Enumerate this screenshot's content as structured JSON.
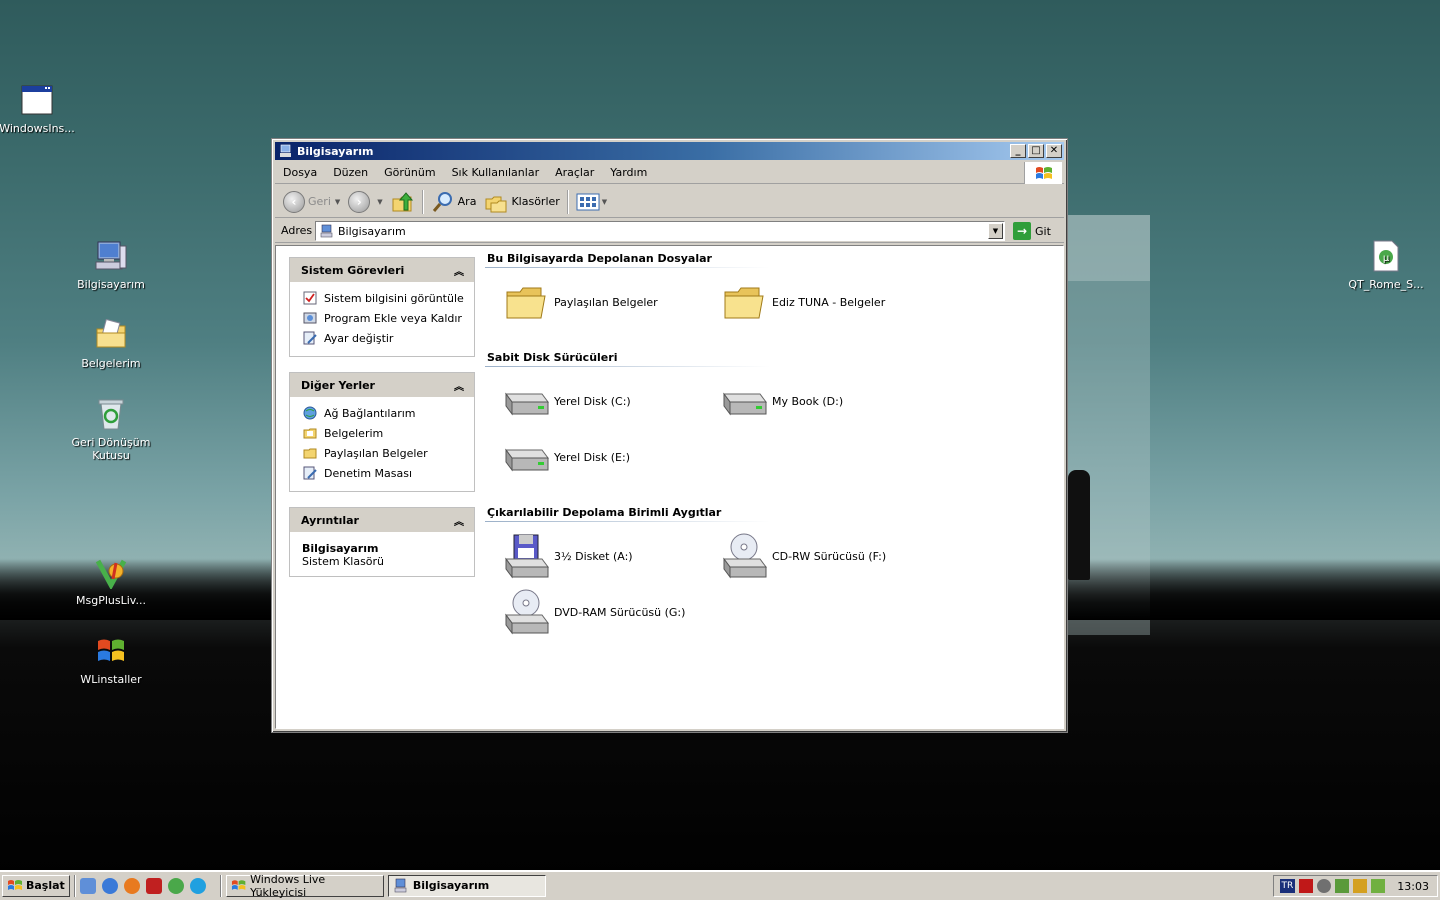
{
  "desktop": {
    "icons": [
      {
        "label": "WindowsIns..."
      },
      {
        "label": "Bilgisayarım"
      },
      {
        "label": "Belgelerim"
      },
      {
        "label": "Geri Dönüşüm Kutusu"
      },
      {
        "label": "MsgPlusLiv..."
      },
      {
        "label": "WLinstaller"
      },
      {
        "label": "QT_Rome_S..."
      }
    ]
  },
  "window": {
    "title": "Bilgisayarım",
    "menu": [
      "Dosya",
      "Düzen",
      "Görünüm",
      "Sık Kullanılanlar",
      "Araçlar",
      "Yardım"
    ],
    "toolbar": {
      "back_label": "Geri",
      "search_label": "Ara",
      "folders_label": "Klasörler"
    },
    "address": {
      "label": "Adres",
      "value": "Bilgisayarım",
      "go_label": "Git"
    },
    "taskpane": {
      "system_tasks": {
        "title": "Sistem Görevleri",
        "items": [
          "Sistem bilgisini görüntüle",
          "Program Ekle veya Kaldır",
          "Ayar değiştir"
        ]
      },
      "other_places": {
        "title": "Diğer Yerler",
        "items": [
          "Ağ Bağlantılarım",
          "Belgelerim",
          "Paylaşılan Belgeler",
          "Denetim Masası"
        ]
      },
      "details": {
        "title": "Ayrıntılar",
        "name": "Bilgisayarım",
        "type": "Sistem Klasörü"
      }
    },
    "groups": {
      "files": {
        "title": "Bu Bilgisayarda Depolanan Dosyalar",
        "items": [
          "Paylaşılan Belgeler",
          "Ediz TUNA - Belgeler"
        ]
      },
      "hdd": {
        "title": "Sabit Disk Sürücüleri",
        "items": [
          "Yerel Disk (C:)",
          "My Book (D:)",
          "Yerel Disk (E:)"
        ]
      },
      "removable": {
        "title": "Çıkarılabilir Depolama Birimli Aygıtlar",
        "items": [
          "3½ Disket (A:)",
          "CD-RW Sürücüsü (F:)",
          "DVD-RAM Sürücüsü (G:)"
        ]
      }
    }
  },
  "taskbar": {
    "start_label": "Başlat",
    "tasks": [
      "Windows Live Yükleyicisi",
      "Bilgisayarım"
    ],
    "language": "TR",
    "clock": "13:03"
  }
}
